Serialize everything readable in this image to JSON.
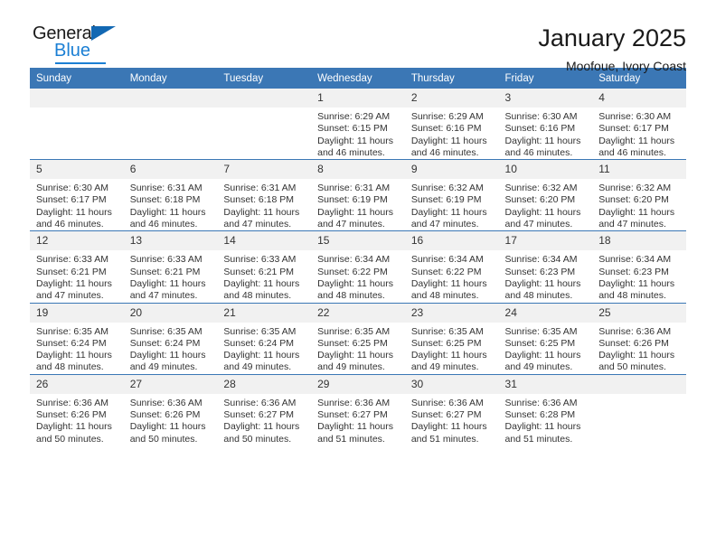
{
  "logo": {
    "word1": "General",
    "word2": "Blue",
    "accent_color": "#1b7fd4",
    "triangle_color": "#1268b3"
  },
  "header": {
    "title": "January 2025",
    "subtitle": "Moofoue, Ivory Coast"
  },
  "theme": {
    "header_row_bg": "#3b77b5",
    "header_row_text": "#ffffff",
    "daynum_bg": "#f1f1f1",
    "grid_line": "#3b77b5"
  },
  "weekdays": [
    "Sunday",
    "Monday",
    "Tuesday",
    "Wednesday",
    "Thursday",
    "Friday",
    "Saturday"
  ],
  "weeks": [
    [
      {
        "day": "",
        "lines": []
      },
      {
        "day": "",
        "lines": []
      },
      {
        "day": "",
        "lines": []
      },
      {
        "day": "1",
        "lines": [
          "Sunrise: 6:29 AM",
          "Sunset: 6:15 PM",
          "Daylight: 11 hours",
          "and 46 minutes."
        ]
      },
      {
        "day": "2",
        "lines": [
          "Sunrise: 6:29 AM",
          "Sunset: 6:16 PM",
          "Daylight: 11 hours",
          "and 46 minutes."
        ]
      },
      {
        "day": "3",
        "lines": [
          "Sunrise: 6:30 AM",
          "Sunset: 6:16 PM",
          "Daylight: 11 hours",
          "and 46 minutes."
        ]
      },
      {
        "day": "4",
        "lines": [
          "Sunrise: 6:30 AM",
          "Sunset: 6:17 PM",
          "Daylight: 11 hours",
          "and 46 minutes."
        ]
      }
    ],
    [
      {
        "day": "5",
        "lines": [
          "Sunrise: 6:30 AM",
          "Sunset: 6:17 PM",
          "Daylight: 11 hours",
          "and 46 minutes."
        ]
      },
      {
        "day": "6",
        "lines": [
          "Sunrise: 6:31 AM",
          "Sunset: 6:18 PM",
          "Daylight: 11 hours",
          "and 46 minutes."
        ]
      },
      {
        "day": "7",
        "lines": [
          "Sunrise: 6:31 AM",
          "Sunset: 6:18 PM",
          "Daylight: 11 hours",
          "and 47 minutes."
        ]
      },
      {
        "day": "8",
        "lines": [
          "Sunrise: 6:31 AM",
          "Sunset: 6:19 PM",
          "Daylight: 11 hours",
          "and 47 minutes."
        ]
      },
      {
        "day": "9",
        "lines": [
          "Sunrise: 6:32 AM",
          "Sunset: 6:19 PM",
          "Daylight: 11 hours",
          "and 47 minutes."
        ]
      },
      {
        "day": "10",
        "lines": [
          "Sunrise: 6:32 AM",
          "Sunset: 6:20 PM",
          "Daylight: 11 hours",
          "and 47 minutes."
        ]
      },
      {
        "day": "11",
        "lines": [
          "Sunrise: 6:32 AM",
          "Sunset: 6:20 PM",
          "Daylight: 11 hours",
          "and 47 minutes."
        ]
      }
    ],
    [
      {
        "day": "12",
        "lines": [
          "Sunrise: 6:33 AM",
          "Sunset: 6:21 PM",
          "Daylight: 11 hours",
          "and 47 minutes."
        ]
      },
      {
        "day": "13",
        "lines": [
          "Sunrise: 6:33 AM",
          "Sunset: 6:21 PM",
          "Daylight: 11 hours",
          "and 47 minutes."
        ]
      },
      {
        "day": "14",
        "lines": [
          "Sunrise: 6:33 AM",
          "Sunset: 6:21 PM",
          "Daylight: 11 hours",
          "and 48 minutes."
        ]
      },
      {
        "day": "15",
        "lines": [
          "Sunrise: 6:34 AM",
          "Sunset: 6:22 PM",
          "Daylight: 11 hours",
          "and 48 minutes."
        ]
      },
      {
        "day": "16",
        "lines": [
          "Sunrise: 6:34 AM",
          "Sunset: 6:22 PM",
          "Daylight: 11 hours",
          "and 48 minutes."
        ]
      },
      {
        "day": "17",
        "lines": [
          "Sunrise: 6:34 AM",
          "Sunset: 6:23 PM",
          "Daylight: 11 hours",
          "and 48 minutes."
        ]
      },
      {
        "day": "18",
        "lines": [
          "Sunrise: 6:34 AM",
          "Sunset: 6:23 PM",
          "Daylight: 11 hours",
          "and 48 minutes."
        ]
      }
    ],
    [
      {
        "day": "19",
        "lines": [
          "Sunrise: 6:35 AM",
          "Sunset: 6:24 PM",
          "Daylight: 11 hours",
          "and 48 minutes."
        ]
      },
      {
        "day": "20",
        "lines": [
          "Sunrise: 6:35 AM",
          "Sunset: 6:24 PM",
          "Daylight: 11 hours",
          "and 49 minutes."
        ]
      },
      {
        "day": "21",
        "lines": [
          "Sunrise: 6:35 AM",
          "Sunset: 6:24 PM",
          "Daylight: 11 hours",
          "and 49 minutes."
        ]
      },
      {
        "day": "22",
        "lines": [
          "Sunrise: 6:35 AM",
          "Sunset: 6:25 PM",
          "Daylight: 11 hours",
          "and 49 minutes."
        ]
      },
      {
        "day": "23",
        "lines": [
          "Sunrise: 6:35 AM",
          "Sunset: 6:25 PM",
          "Daylight: 11 hours",
          "and 49 minutes."
        ]
      },
      {
        "day": "24",
        "lines": [
          "Sunrise: 6:35 AM",
          "Sunset: 6:25 PM",
          "Daylight: 11 hours",
          "and 49 minutes."
        ]
      },
      {
        "day": "25",
        "lines": [
          "Sunrise: 6:36 AM",
          "Sunset: 6:26 PM",
          "Daylight: 11 hours",
          "and 50 minutes."
        ]
      }
    ],
    [
      {
        "day": "26",
        "lines": [
          "Sunrise: 6:36 AM",
          "Sunset: 6:26 PM",
          "Daylight: 11 hours",
          "and 50 minutes."
        ]
      },
      {
        "day": "27",
        "lines": [
          "Sunrise: 6:36 AM",
          "Sunset: 6:26 PM",
          "Daylight: 11 hours",
          "and 50 minutes."
        ]
      },
      {
        "day": "28",
        "lines": [
          "Sunrise: 6:36 AM",
          "Sunset: 6:27 PM",
          "Daylight: 11 hours",
          "and 50 minutes."
        ]
      },
      {
        "day": "29",
        "lines": [
          "Sunrise: 6:36 AM",
          "Sunset: 6:27 PM",
          "Daylight: 11 hours",
          "and 51 minutes."
        ]
      },
      {
        "day": "30",
        "lines": [
          "Sunrise: 6:36 AM",
          "Sunset: 6:27 PM",
          "Daylight: 11 hours",
          "and 51 minutes."
        ]
      },
      {
        "day": "31",
        "lines": [
          "Sunrise: 6:36 AM",
          "Sunset: 6:28 PM",
          "Daylight: 11 hours",
          "and 51 minutes."
        ]
      },
      {
        "day": "",
        "lines": []
      }
    ]
  ]
}
